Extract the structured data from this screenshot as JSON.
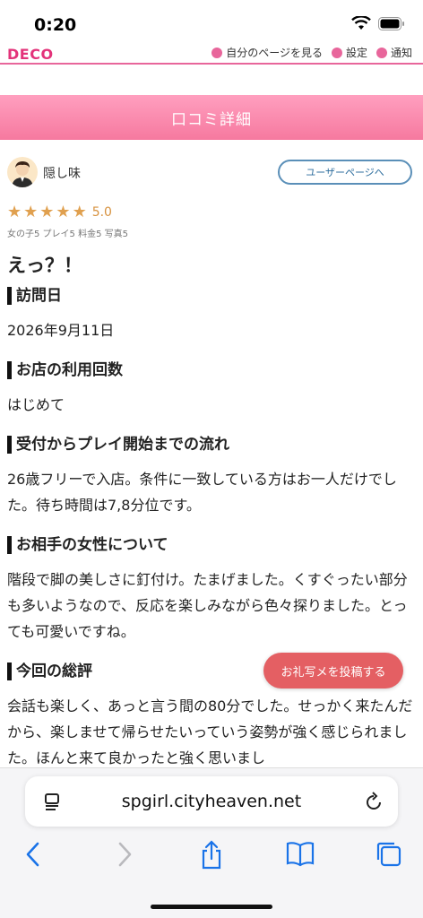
{
  "status": {
    "time": "0:20"
  },
  "header": {
    "logo": "DECO",
    "links": [
      "自分のページを見る",
      "設定",
      "通知"
    ]
  },
  "page": {
    "title": "口コミ詳細"
  },
  "user": {
    "name": "隠し味",
    "user_page_button": "ユーザーページへ"
  },
  "rating": {
    "value": "5.0",
    "stars": 5,
    "sub_scores": "女の子5 プレイ5 料金5 写真5"
  },
  "review": {
    "title": "えっ？！",
    "sections": [
      {
        "heading": "訪問日",
        "body": "2026年9月11日"
      },
      {
        "heading": "お店の利用回数",
        "body": "はじめて"
      },
      {
        "heading": "受付からプレイ開始までの流れ",
        "body": "26歳フリーで入店。条件に一致している方はお一人だけでした。待ち時間は7,8分位です。"
      },
      {
        "heading": "お相手の女性について",
        "body": "階段で脚の美しさに釘付け。たまげました。くすぐったい部分も多いようなので、反応を楽しみながら色々探りました。とっても可愛いですね。"
      },
      {
        "heading": "今回の総評",
        "body": "会話も楽しく、あっと言う間の80分でした。せっかく来たんだから、楽しませて帰らせたいっていう姿勢が強く感じられました。ほんと来て良かったと強く思いまし"
      }
    ]
  },
  "cta": {
    "label": "お礼写メを投稿する"
  },
  "browser": {
    "url": "spgirl.cityheaven.net"
  },
  "colors": {
    "accent": "#f6799f",
    "cta": "#e45f63",
    "star": "#e0a04f",
    "button_border": "#5a8fb8"
  }
}
